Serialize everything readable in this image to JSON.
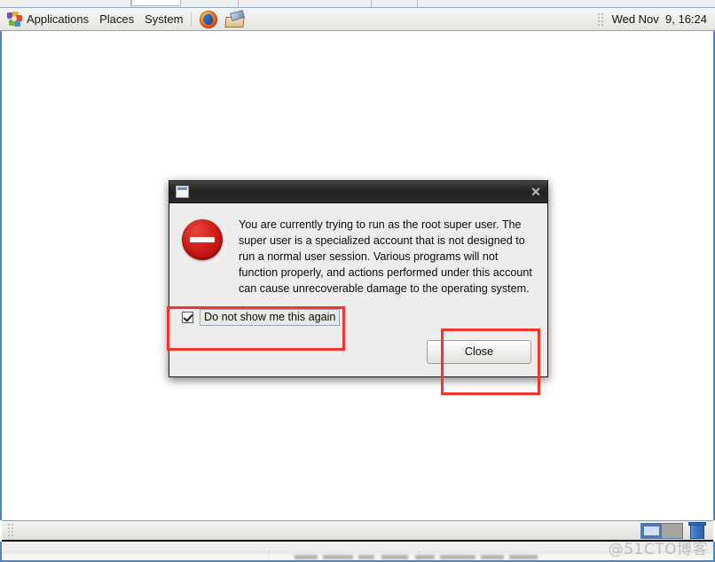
{
  "desktop": {
    "environment": "GNOME",
    "wallpaper_color": "#16305e",
    "accent_color": "#4a86c8"
  },
  "top_panel": {
    "apps_logo_name": "gnome-applications-logo",
    "menus": [
      {
        "label": "Applications"
      },
      {
        "label": "Places"
      },
      {
        "label": "System"
      }
    ],
    "launchers": [
      {
        "name": "firefox-icon",
        "title": "Firefox Web Browser"
      },
      {
        "name": "mail-icon",
        "title": "Evolution Mail"
      }
    ],
    "clock": "Wed Nov  9, 16:24"
  },
  "dialog": {
    "title": "",
    "window_icon_name": "window-icon",
    "close_button_glyph": "✕",
    "icon_name": "error-stop-icon",
    "icon_color": "#cf1c17",
    "message": "You are currently trying to run as the root super user.  The super user is a specialized account that is not designed to run a normal user session.  Various programs will not function properly, and actions performed under this account can cause unrecoverable damage to the operating system.",
    "checkbox": {
      "label": "Do not show me this again",
      "checked": true,
      "check_glyph": "✓"
    },
    "buttons": [
      {
        "label": "Close",
        "primary": true
      }
    ]
  },
  "annotations": [
    {
      "name": "checkbox-highlight",
      "color": "#f5352b",
      "target": "do-not-show-checkbox"
    },
    {
      "name": "close-button-highlight",
      "color": "#f5352b",
      "target": "close-button"
    }
  ],
  "bottom_panel": {
    "grip_name": "panel-drag-grip",
    "workspaces": [
      {
        "name": "workspace-1",
        "active": true
      },
      {
        "name": "workspace-2",
        "active": false
      }
    ],
    "trash": {
      "name": "trash-icon",
      "label": "Trash"
    }
  },
  "watermark": "@51CTO博客"
}
